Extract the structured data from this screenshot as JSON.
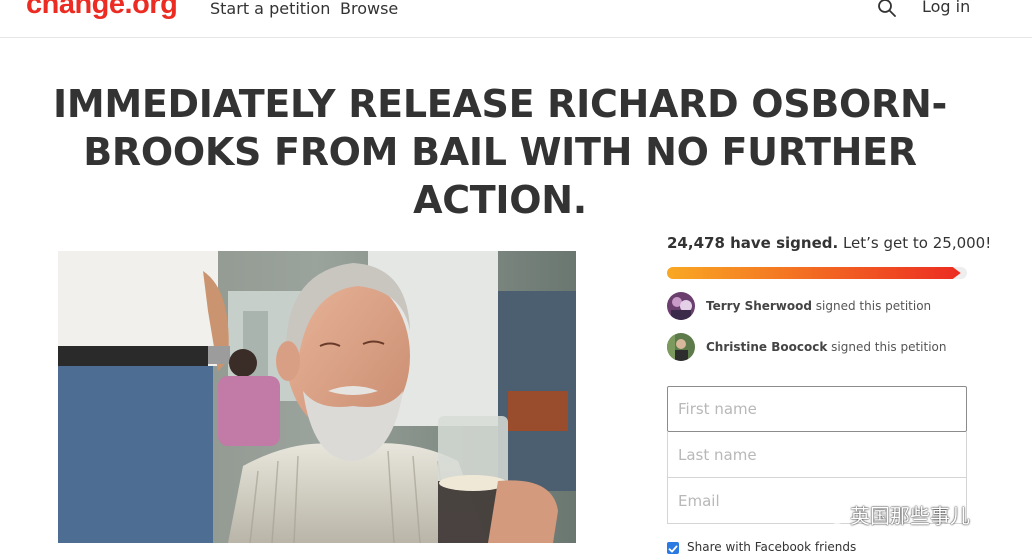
{
  "header": {
    "logo": "change.org",
    "nav": {
      "start_petition": "Start a petition",
      "browse": "Browse",
      "login": "Log in"
    },
    "search_icon": "search-icon"
  },
  "petition": {
    "title": "IMMEDIATELY RELEASE RICHARD OSBORN-BROOKS FROM BAIL WITH NO FURTHER ACTION."
  },
  "signatures": {
    "count": "24,478 have signed.",
    "goal_text": " Let’s get to 25,000!",
    "progress": 0.979,
    "recent": [
      {
        "name": "Terry Sherwood",
        "action": " signed this petition"
      },
      {
        "name": "Christine Boocock",
        "action": " signed this petition"
      }
    ]
  },
  "form": {
    "first_name_placeholder": "First name",
    "last_name_placeholder": "Last name",
    "email_placeholder": "Email",
    "share_label": "Share with Facebook friends",
    "share_checked": true
  },
  "watermark": {
    "text": "英国那些事儿",
    "icon": "wechat-icon"
  },
  "colors": {
    "brand": "#ec2c22",
    "progress_start": "#f9a823",
    "progress_end": "#ec2c22",
    "checkbox": "#2a7ae2"
  }
}
